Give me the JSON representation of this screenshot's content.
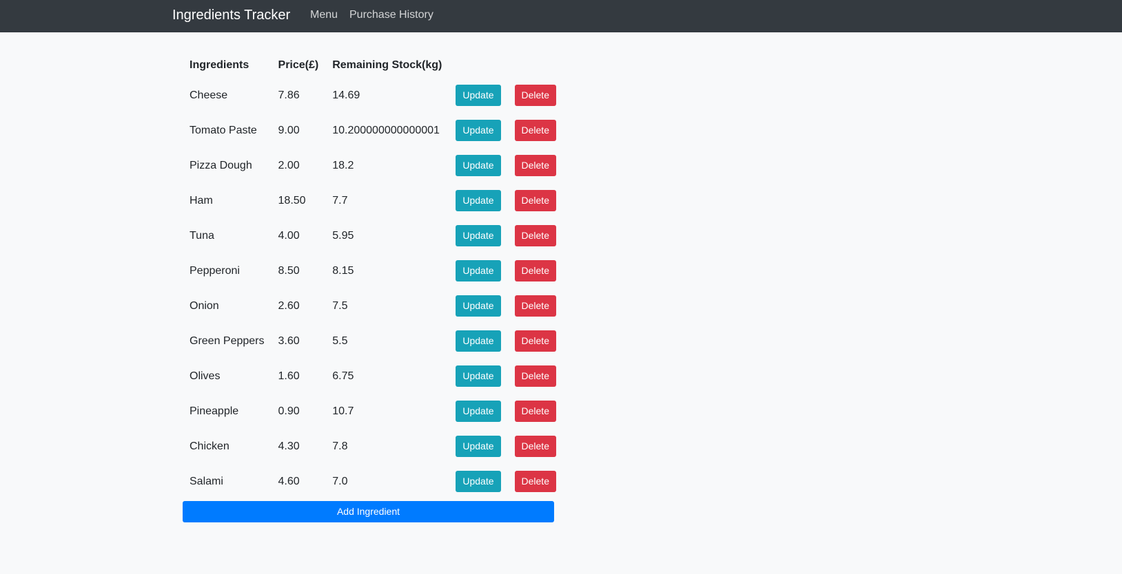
{
  "navbar": {
    "brand": "Ingredients Tracker",
    "links": [
      "Menu",
      "Purchase History"
    ]
  },
  "table": {
    "headers": [
      "Ingredients",
      "Price(£)",
      "Remaining Stock(kg)"
    ],
    "rows": [
      {
        "name": "Cheese",
        "price": "7.86",
        "stock": "14.69"
      },
      {
        "name": "Tomato Paste",
        "price": "9.00",
        "stock": "10.200000000000001"
      },
      {
        "name": "Pizza Dough",
        "price": "2.00",
        "stock": "18.2"
      },
      {
        "name": "Ham",
        "price": "18.50",
        "stock": "7.7"
      },
      {
        "name": "Tuna",
        "price": "4.00",
        "stock": "5.95"
      },
      {
        "name": "Pepperoni",
        "price": "8.50",
        "stock": "8.15"
      },
      {
        "name": "Onion",
        "price": "2.60",
        "stock": "7.5"
      },
      {
        "name": "Green Peppers",
        "price": "3.60",
        "stock": "5.5"
      },
      {
        "name": "Olives",
        "price": "1.60",
        "stock": "6.75"
      },
      {
        "name": "Pineapple",
        "price": "0.90",
        "stock": "10.7"
      },
      {
        "name": "Chicken",
        "price": "4.30",
        "stock": "7.8"
      },
      {
        "name": "Salami",
        "price": "4.60",
        "stock": "7.0"
      }
    ],
    "update_label": "Update",
    "delete_label": "Delete"
  },
  "add_button_label": "Add Ingredient",
  "colors": {
    "navbar": "#343a40",
    "update": "#17a2b8",
    "delete": "#dc3545",
    "add": "#007bff"
  }
}
